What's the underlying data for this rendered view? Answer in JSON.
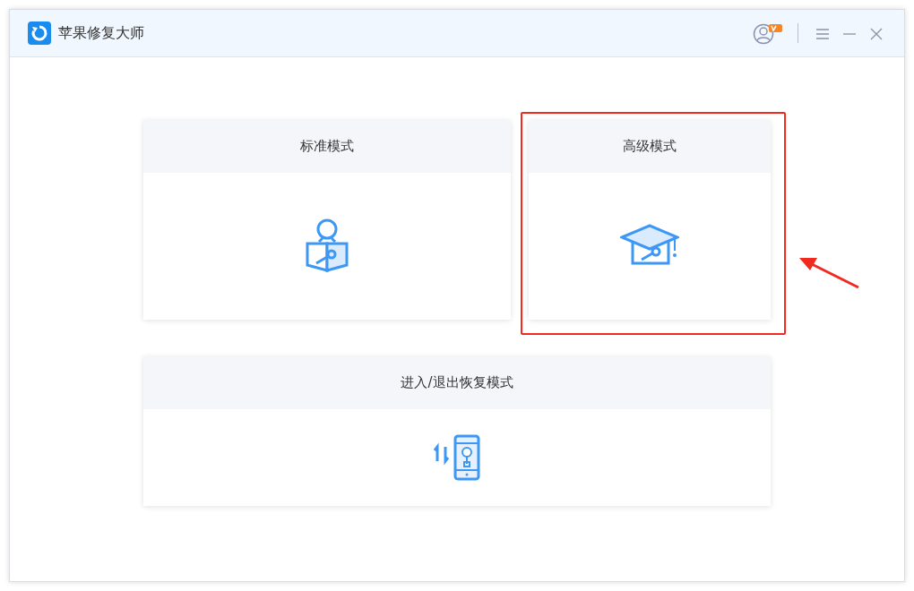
{
  "window": {
    "title": "苹果修复大师"
  },
  "modes": [
    {
      "kind": "standard",
      "title": "标准模式",
      "highlighted": false
    },
    {
      "kind": "advanced",
      "title": "高级模式",
      "highlighted": true
    },
    {
      "kind": "recovery",
      "title": "进入/退出恢复模式",
      "highlighted": false
    }
  ]
}
